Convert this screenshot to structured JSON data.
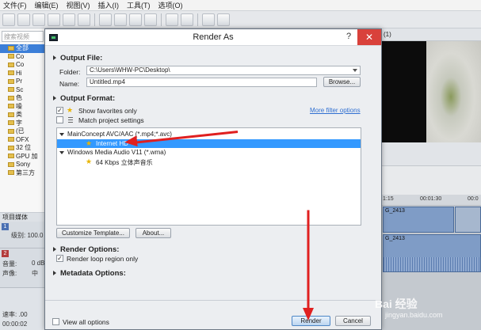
{
  "menubar": {
    "items": [
      "文件(F)",
      "编辑(E)",
      "视图(V)",
      "插入(I)",
      "工具(T)",
      "选项(O)"
    ]
  },
  "left_pane": {
    "search_placeholder": "搜索视频",
    "tree": [
      {
        "label": "全部",
        "selected": true
      },
      {
        "label": "Co",
        "selected": false
      },
      {
        "label": "Co",
        "selected": false
      },
      {
        "label": "Hi",
        "selected": false
      },
      {
        "label": "Pr",
        "selected": false
      },
      {
        "label": "Sc",
        "selected": false
      },
      {
        "label": "色",
        "selected": false
      },
      {
        "label": "噪",
        "selected": false
      },
      {
        "label": "类",
        "selected": false
      },
      {
        "label": "字",
        "selected": false
      },
      {
        "label": "(已",
        "selected": false
      },
      {
        "label": "OFX",
        "selected": false
      },
      {
        "label": "32 位",
        "selected": false
      },
      {
        "label": "GPU 加",
        "selected": false
      },
      {
        "label": "Sony",
        "selected": false
      },
      {
        "label": "第三方",
        "selected": false
      }
    ],
    "pane_label": "项目媒体"
  },
  "tracks": {
    "track1": {
      "number": "1",
      "line": "级别: 100.0"
    },
    "track2": {
      "number": "2",
      "vol": "音量:",
      "vol_val": "0 dB",
      "pan": "声像:",
      "pan_val": "中"
    }
  },
  "status": {
    "rate": "速率: .00",
    "time": "00:00:02"
  },
  "right": {
    "toolbar_label": "(1)",
    "ruler": [
      "1:15",
      "00:01:30",
      "00:0"
    ],
    "clip1": "G_2413",
    "clip2": "G_2413"
  },
  "dialog": {
    "title": "Render As",
    "help": "?",
    "close": "✕",
    "output_file": {
      "heading": "Output File:",
      "folder_label": "Folder:",
      "folder_value": "C:\\Users\\WHW-PC\\Desktop\\",
      "name_label": "Name:",
      "name_value": "Untitled.mp4",
      "browse": "Browse..."
    },
    "output_format": {
      "heading": "Output Format:",
      "show_favorites": "Show favorites only",
      "show_favorites_checked": true,
      "match_project": "Match project settings",
      "match_project_checked": false,
      "more_filter": "More filter options",
      "groups": [
        {
          "label": "MainConcept AVC/AAC (*.mp4;*.avc)",
          "items": [
            {
              "label": "Internet HD",
              "selected": true
            }
          ]
        },
        {
          "label": "Windows Media Audio V11 (*.wma)",
          "items": [
            {
              "label": "64 Kbps 立体声音乐",
              "selected": false
            }
          ]
        }
      ],
      "customize_template": "Customize Template...",
      "about": "About..."
    },
    "render_options": {
      "heading": "Render Options:",
      "loop_region": "Render loop region only",
      "loop_region_checked": true
    },
    "metadata_options": {
      "heading": "Metadata Options:"
    },
    "footer": {
      "view_all": "View all options",
      "view_all_checked": false,
      "render": "Render",
      "cancel": "Cancel",
      "help": "?"
    }
  },
  "watermark": {
    "text": "Bai 经验",
    "sub": "jingyan.baidu.com"
  },
  "colors": {
    "arrow": "#e02020",
    "selection": "#3399ff",
    "close": "#d9413b"
  }
}
